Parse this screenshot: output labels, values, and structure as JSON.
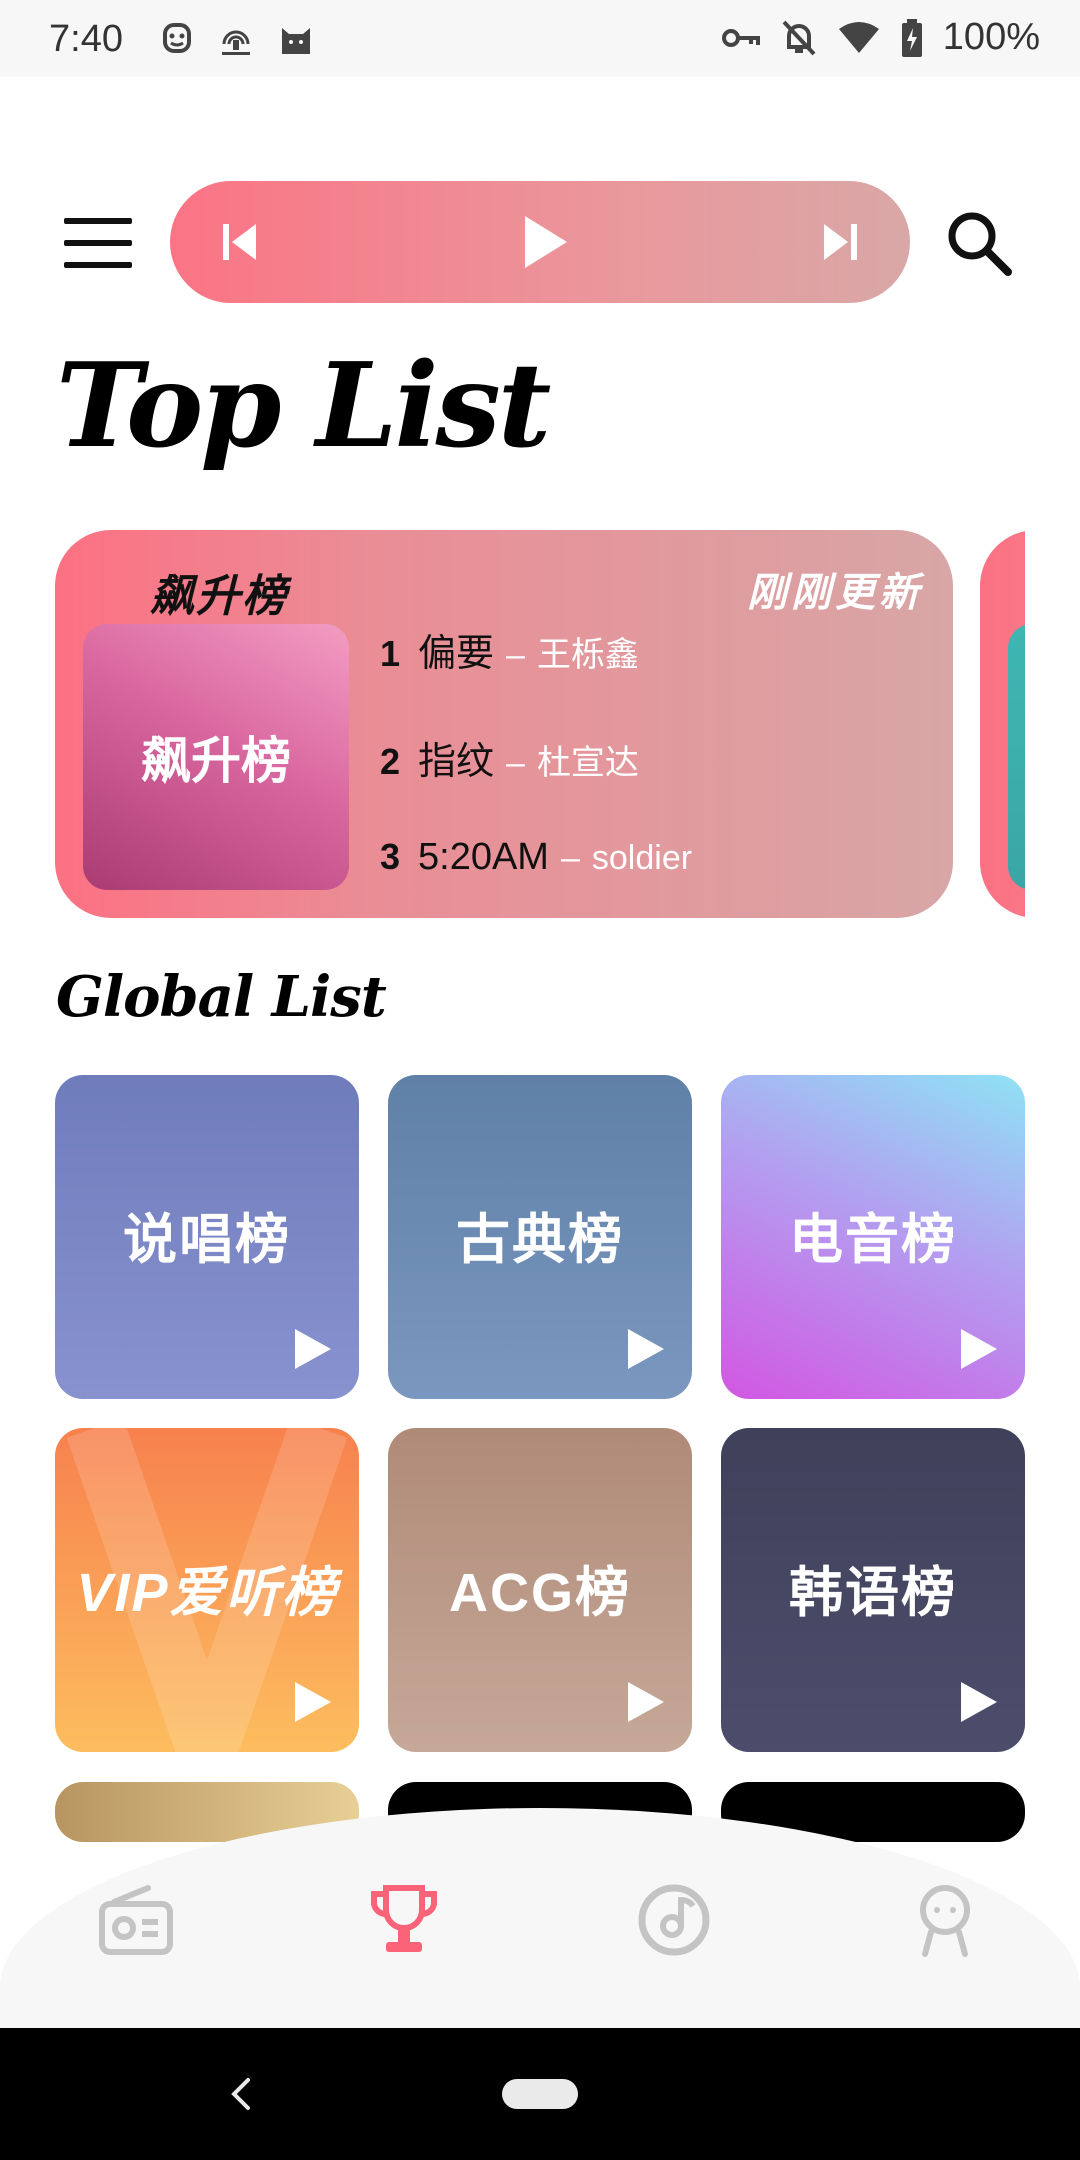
{
  "status_bar": {
    "time": "7:40",
    "battery": "100%",
    "left_icons": [
      "face-icon",
      "fingerprint-app-icon",
      "cat-icon"
    ],
    "right_icons": [
      "vpn-key-icon",
      "notifications-off-icon",
      "wifi-icon",
      "battery-charging-icon"
    ]
  },
  "header": {
    "menu_icon": "menu-icon",
    "player": {
      "prev_icon": "skip-previous-icon",
      "play_icon": "play-icon",
      "next_icon": "skip-next-icon",
      "gradient": [
        "#fb7485",
        "#d9a7a7"
      ]
    },
    "search_icon": "search-icon"
  },
  "page_title": "Top List",
  "top_card": {
    "handwritten_title": "飙升榜",
    "updated_label": "刚刚更新",
    "cover_label": "飙升榜",
    "tracks": [
      {
        "rank": "1",
        "song": "偏要",
        "dash": "–",
        "artist": "王栎鑫"
      },
      {
        "rank": "2",
        "song": "指纹",
        "dash": "–",
        "artist": "杜宣达"
      },
      {
        "rank": "3",
        "song": "5:20AM",
        "dash": "–",
        "artist": "soldier"
      }
    ]
  },
  "section_title": "Global List",
  "global_list": [
    {
      "label": "说唱榜",
      "colors": [
        "#6f7cbc",
        "#8892cf"
      ]
    },
    {
      "label": "古典榜",
      "colors": [
        "#5f80a7",
        "#7a97bf"
      ]
    },
    {
      "label": "电音榜",
      "colors": [
        "#d257e2",
        "#8fe2f5"
      ]
    },
    {
      "label": "VIP爱听榜",
      "colors": [
        "#f7814e",
        "#fdbd5e"
      ]
    },
    {
      "label": "ACG榜",
      "colors": [
        "#b08a78",
        "#c6a898"
      ]
    },
    {
      "label": "韩语榜",
      "colors": [
        "#3f415b",
        "#4b4d6b"
      ]
    }
  ],
  "bottom_nav": [
    {
      "name": "radio-icon",
      "active": false
    },
    {
      "name": "trophy-icon",
      "active": true
    },
    {
      "name": "music-disc-icon",
      "active": false
    },
    {
      "name": "profile-icon",
      "active": false
    }
  ],
  "accent_color": "#fb6378"
}
